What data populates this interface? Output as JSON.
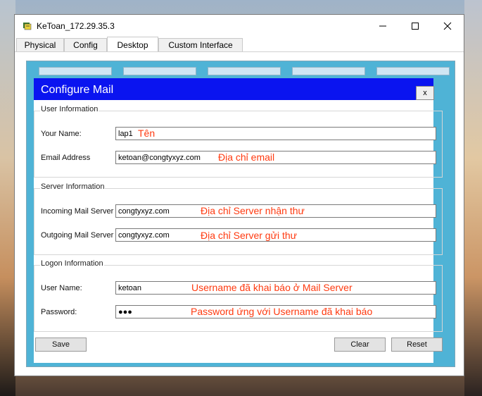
{
  "window": {
    "title": "KeToan_172.29.35.3"
  },
  "tabs": [
    {
      "label": "Physical"
    },
    {
      "label": "Config"
    },
    {
      "label": "Desktop",
      "active": true
    },
    {
      "label": "Custom Interface"
    }
  ],
  "dialog": {
    "title": "Configure Mail",
    "close_label": "x"
  },
  "user_info": {
    "legend": "User Information",
    "name_label": "Your Name:",
    "name_value": "lap1",
    "name_note": "Tên",
    "email_label": "Email Address",
    "email_value": "ketoan@congtyxyz.com",
    "email_note": "Địa chỉ email"
  },
  "server_info": {
    "legend": "Server Information",
    "incoming_label": "Incoming Mail Server",
    "incoming_value": "congtyxyz.com",
    "incoming_note": "Địa chỉ Server nhận thư",
    "outgoing_label": "Outgoing Mail Server",
    "outgoing_value": "congtyxyz.com",
    "outgoing_note": "Địa chỉ Server gửi thư"
  },
  "logon_info": {
    "legend": "Logon Information",
    "username_label": "User Name:",
    "username_value": "ketoan",
    "username_note": "Username đã khai báo ở Mail Server",
    "password_label": "Password:",
    "password_value": "●●●",
    "password_note": "Password ứng với Username đã khai báo"
  },
  "buttons": {
    "save": "Save",
    "clear": "Clear",
    "reset": "Reset"
  },
  "colors": {
    "dialog_title_bg": "#0a14f0",
    "note_text": "#ff3a10",
    "desktop_bg": "#4fb3d6"
  }
}
